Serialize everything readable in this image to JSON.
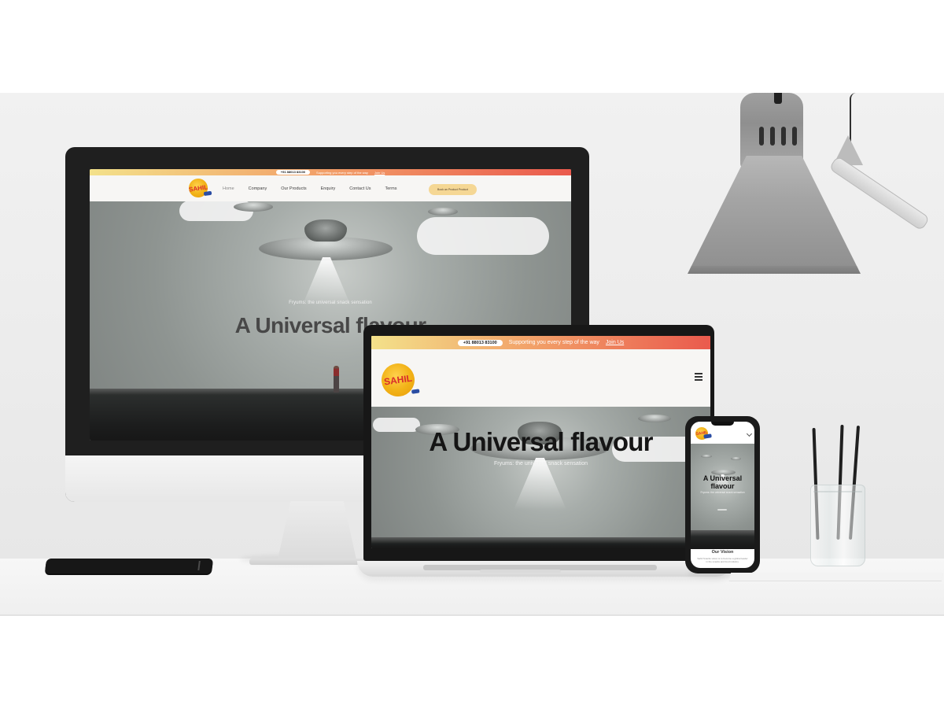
{
  "desktop": {
    "topbar": {
      "phone": "+91 88013 83100",
      "message": "Supporting you every step of the way",
      "link": "Join Us"
    },
    "nav": {
      "logo": "SAHIL",
      "items": [
        "Home",
        "Company",
        "Our Products",
        "Enquiry",
        "Contact Us",
        "Terms"
      ],
      "cta": "Book an Product Product"
    },
    "hero": {
      "kicker": "Fryums: the universal snack sensation",
      "title": "A Universal flavour"
    }
  },
  "laptop": {
    "topbar": {
      "phone": "+91 88013 83100",
      "message": "Supporting you every step of the way",
      "link": "Join Us"
    },
    "nav": {
      "logo": "SAHIL"
    },
    "hero": {
      "title": "A Universal flavour",
      "kicker": "Fryums: the universal snack sensation"
    }
  },
  "phone": {
    "nav": {
      "logo": "SAHIL"
    },
    "hero": {
      "title_line1": "A Universal",
      "title_line2": "flavour",
      "kicker": "Fryums: the universal snack sensation"
    },
    "section": {
      "title": "Our Vision",
      "copy": "Sahil Snacks vision is to become a global leader in the snacks and food industry."
    }
  },
  "icons": {
    "menu": "hamburger-menu-icon",
    "phone_menu": "chevron-down-icon"
  },
  "colors": {
    "topbar_start": "#f3e18a",
    "topbar_end": "#ea5a4d",
    "logo_gold": "#f2b318",
    "logo_red": "#d92b2b",
    "cta_bg": "#f5d794"
  }
}
